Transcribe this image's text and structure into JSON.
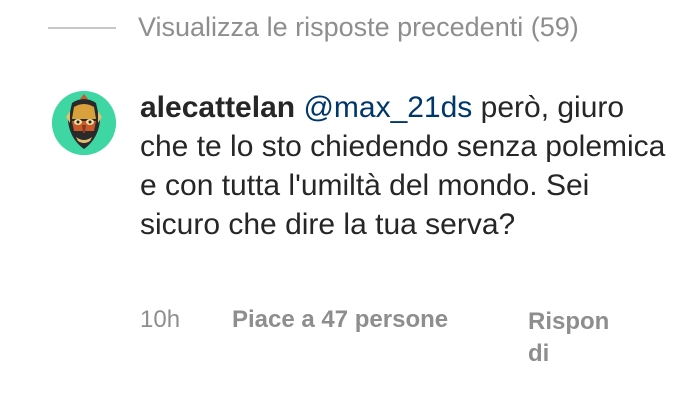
{
  "thread": {
    "view_previous_label": "Visualizza le risposte precedenti (59)"
  },
  "comment": {
    "avatar_icon": "illustrated-mask-avatar",
    "username": "alecattelan",
    "mention": "@max_21ds",
    "text": " però, giuro che te lo sto chiedendo senza polemica e con tutta l'umiltà del mondo. Sei sicuro che dire la tua serva?",
    "time": "10h",
    "likes": "Piace a 47 persone",
    "reply_label": "Rispondi"
  },
  "colors": {
    "avatar_bg": "#3ed6a3",
    "mention": "#00376b",
    "muted": "#8e8e8e",
    "text": "#262626"
  }
}
